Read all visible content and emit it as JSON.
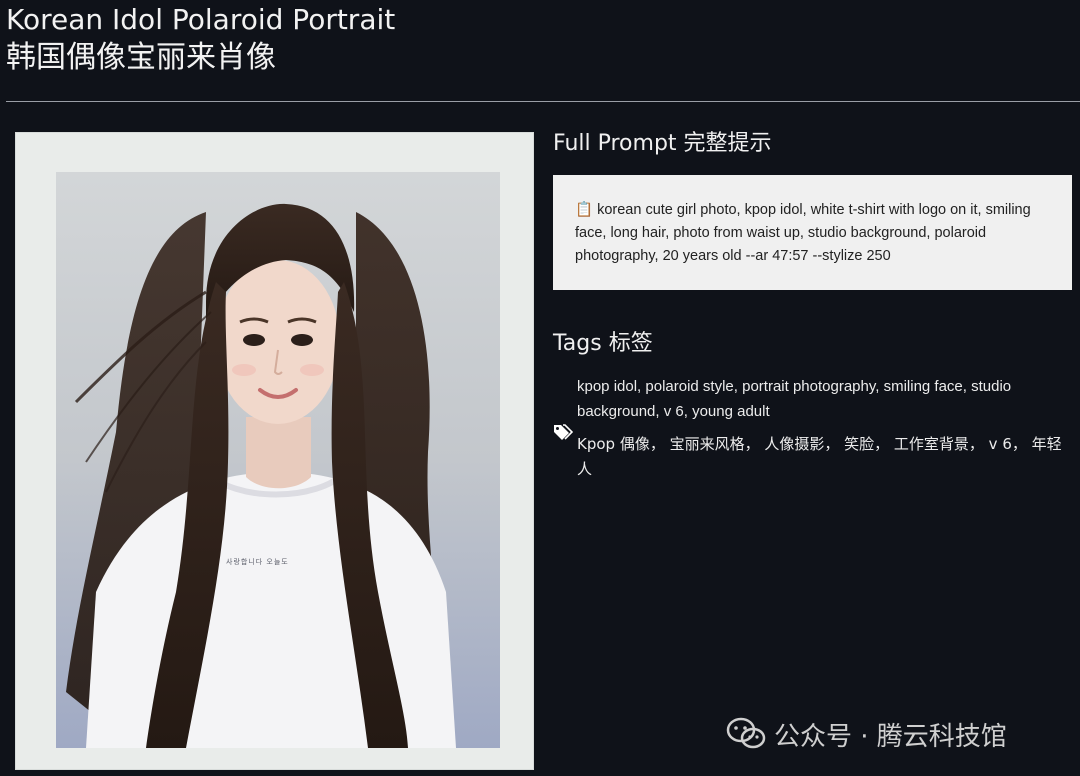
{
  "header": {
    "title_en": "Korean Idol Polaroid Portrait",
    "title_zh": "韩国偶像宝丽来肖像"
  },
  "image": {
    "subject": "polaroid-portrait",
    "shirt_print": "사랑합니다 오늘도"
  },
  "prompt_section": {
    "heading": "Full Prompt 完整提示",
    "text": "📋 korean cute girl photo, kpop idol, white t-shirt with logo on it, smiling face, long hair, photo from waist up, studio background, polaroid photography, 20 years old --ar 47:57 --stylize 250"
  },
  "tags_section": {
    "heading": "Tags 标签",
    "tags_en": "kpop idol, polaroid style, portrait photography, smiling face, studio background, v 6, young adult",
    "tags_zh": "Kpop 偶像， 宝丽来风格， 人像摄影， 笑脸， 工作室背景， v 6， 年轻人",
    "icon": "tag-icon"
  },
  "watermark": {
    "text": "公众号 · 腾云科技馆",
    "icon": "wechat-icon"
  },
  "colors": {
    "background": "#0f1219",
    "prompt_box": "#f0f0f0",
    "polaroid_frame": "#e9ecea"
  }
}
